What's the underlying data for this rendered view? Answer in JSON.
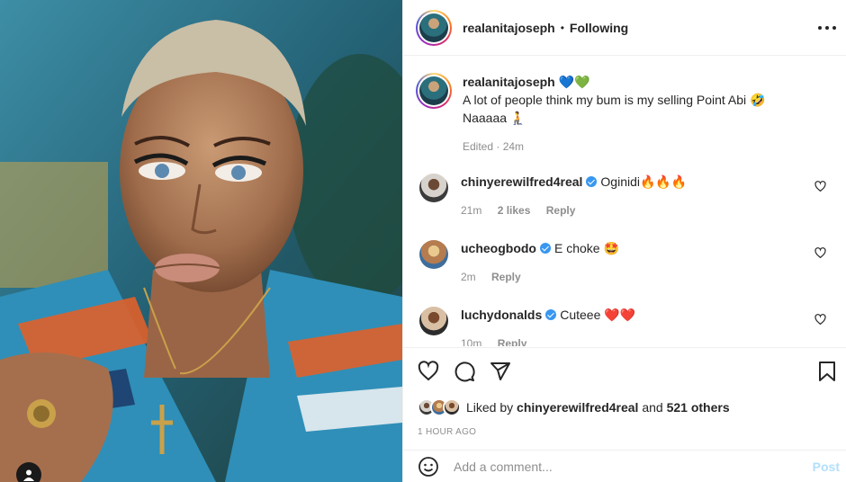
{
  "post": {
    "author": "realanitajoseph",
    "follow_status": "Following",
    "separator": "•",
    "caption_line1": "A lot of people think my bum is my selling Point Abi 🤣",
    "caption_line2": "Naaaaa 🧎",
    "author_emojis": "💙💚",
    "caption_meta": "Edited · 24m"
  },
  "comments": [
    {
      "user": "chinyerewilfred4real",
      "text": "Oginidi🔥🔥🔥",
      "time": "21m",
      "likes": "2 likes",
      "reply": "Reply"
    },
    {
      "user": "ucheogbodo",
      "text": "E choke 🤩",
      "time": "2m",
      "likes": "",
      "reply": "Reply"
    },
    {
      "user": "luchydonalds",
      "text": "Cuteee ❤️❤️",
      "time": "10m",
      "likes": "",
      "reply": "Reply"
    }
  ],
  "engagement": {
    "liked_by_prefix": "Liked by",
    "liked_by_user": "chinyerewilfred4real",
    "liked_by_and": "and",
    "others": "521 others",
    "timestamp": "1 HOUR AGO"
  },
  "composer": {
    "placeholder": "Add a comment...",
    "post_label": "Post"
  },
  "icons": {
    "more": "more-horizontal-icon",
    "like": "heart-icon",
    "comment": "comment-icon",
    "share": "share-icon",
    "save": "bookmark-icon",
    "emoji": "emoji-icon",
    "user": "user-tag-icon"
  },
  "colors": {
    "verified": "#3897f0",
    "post_disabled": "#b2dffc",
    "muted": "#8e8e8e"
  }
}
